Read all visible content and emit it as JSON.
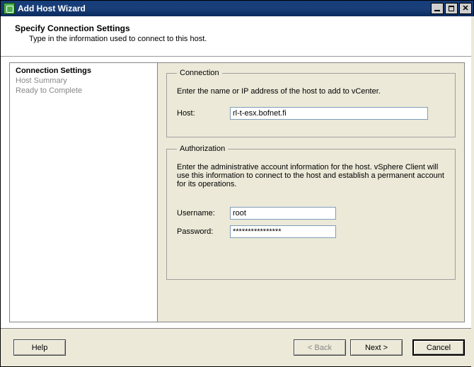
{
  "window": {
    "title": "Add Host Wizard"
  },
  "header": {
    "title": "Specify Connection Settings",
    "subtitle": "Type in the information used to connect to this host."
  },
  "sidebar": {
    "steps": [
      {
        "label": "Connection Settings",
        "state": "current"
      },
      {
        "label": "Host Summary",
        "state": "disabled"
      },
      {
        "label": "Ready to Complete",
        "state": "disabled"
      }
    ]
  },
  "connection": {
    "legend": "Connection",
    "instruction": "Enter the name or IP address of the host to add to vCenter.",
    "host_label": "Host:",
    "host_value": "rl-t-esx.bofnet.fi"
  },
  "authorization": {
    "legend": "Authorization",
    "instruction": "Enter the administrative account information for the host. vSphere Client will use this information to connect to the host and establish a permanent account for its operations.",
    "username_label": "Username:",
    "username_value": "root",
    "password_label": "Password:",
    "password_value": "****************"
  },
  "footer": {
    "help": "Help",
    "back": "< Back",
    "next": "Next >",
    "cancel": "Cancel"
  }
}
